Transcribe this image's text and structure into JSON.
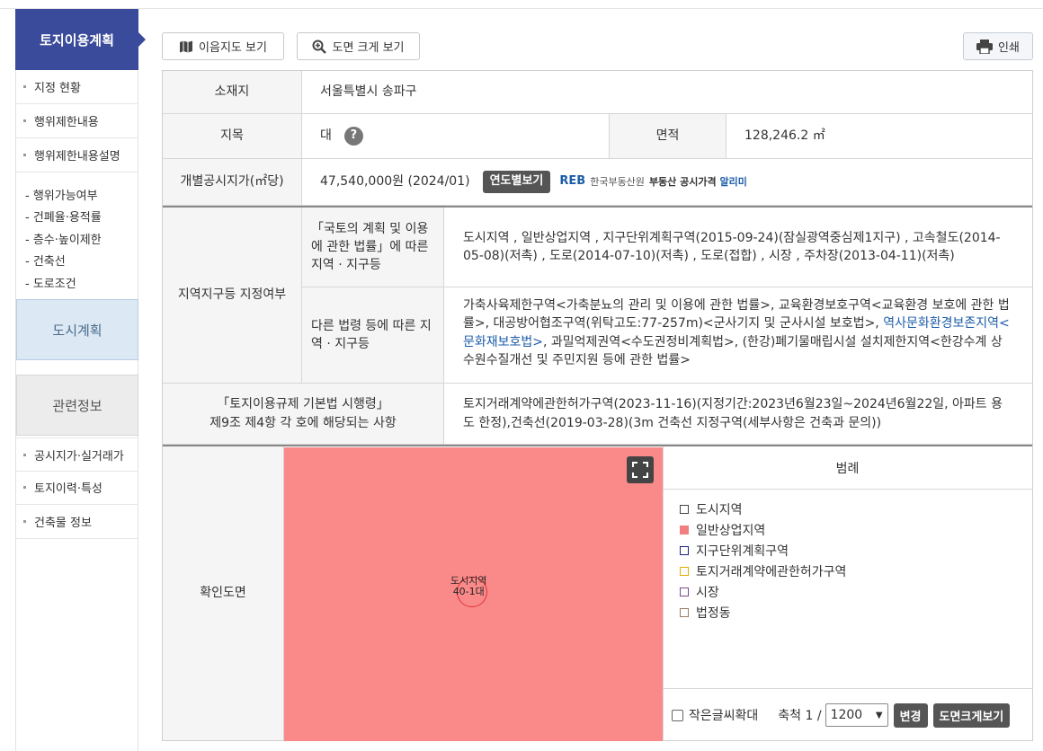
{
  "sidebar": {
    "title": "토지이용계획",
    "items": [
      "지정 현황",
      "행위제한내용",
      "행위제한내용설명"
    ],
    "sub_items": [
      "- 행위가능여부",
      "- 건폐율·용적률",
      "- 층수·높이제한",
      "- 건축선",
      "- 도로조건"
    ],
    "city_plan": "도시계획",
    "related": "관련정보",
    "bottom_items": [
      "공시지가·실거래가",
      "토지이력·특성",
      "건축물 정보"
    ]
  },
  "toolbar": {
    "land_map": "이음지도 보기",
    "zoom_map": "도면 크게 보기",
    "print": "인쇄"
  },
  "info": {
    "location_label": "소재지",
    "location_value": "서울특별시 송파구",
    "category_label": "지목",
    "category_value": "대",
    "area_label": "면적",
    "area_value": "128,246.2 ㎡",
    "price_label": "개별공시지가(㎡당)",
    "price_value": "47,540,000원 (2024/01)",
    "year_button": "연도별보기",
    "reb_logo": "REB",
    "reb_org": "한국부동산원",
    "reb_service": "부동산 공시가격",
    "reb_service_accent": "알리미"
  },
  "zones": {
    "label": "지역지구등 지정여부",
    "national_label": "「국토의 계획 및 이용에 관한 법률」에 따른 지역 · 지구등",
    "national_value": "도시지역 , 일반상업지역 , 지구단위계획구역(2015-09-24)(잠실광역중심제1지구) , 고속철도(2014-05-08)(저촉) , 도로(2014-07-10)(저촉) , 도로(접합) , 시장 , 주차장(2013-04-11)(저촉)",
    "other_label": "다른 법령 등에 따른 지역 · 지구등",
    "other_value_a": "가축사육제한구역<가축분뇨의 관리 및 이용에 관한 법률>, 교육환경보호구역<교육환경 보호에 관한 법률>, 대공방어협조구역(위탁고도:77-257m)<군사기지 및 군사시설 보호법>, ",
    "other_value_link": "역사문화환경보존지역<문화재보호법>",
    "other_value_b": ", 과밀억제권역<수도권정비계획법>, (한강)폐기물매립시설 설치제한지역<한강수계 상수원수질개선 및 주민지원 등에 관한 법률>",
    "reg_label_1": "「토지이용규제 기본법 시행령」",
    "reg_label_2": "제9조 제4항 각 호에 해당되는 사항",
    "reg_value": "토지거래계약에관한허가구역(2023-11-16)(지정기간:2023년6월23일~2024년6월22일, 아파트 용도 한정),건축선(2019-03-28)(3m 건축선 지정구역(세부사항은 건축과 문의))"
  },
  "map": {
    "label": "확인도면",
    "map_text_1": "도시지역",
    "map_text_2": "40-1대",
    "legend_title": "범례",
    "legend": [
      {
        "name": "도시지역",
        "fill": "#ffffff",
        "border": "#444444"
      },
      {
        "name": "일반상업지역",
        "fill": "#f08080",
        "border": "#f08080"
      },
      {
        "name": "지구단위계획구역",
        "fill": "#ffffff",
        "border": "#1a237e"
      },
      {
        "name": "토지거래계약에관한허가구역",
        "fill": "#ffffff",
        "border": "#e0b000"
      },
      {
        "name": "시장",
        "fill": "#ffffff",
        "border": "#7a4a8a"
      },
      {
        "name": "법정동",
        "fill": "#ffffff",
        "border": "#9a7a6a"
      }
    ],
    "small_text": "작은글씨확대",
    "scale_label": "축척 1 /",
    "scale_value": "1200",
    "change_btn": "변경",
    "zoom_btn": "도면크게보기"
  }
}
